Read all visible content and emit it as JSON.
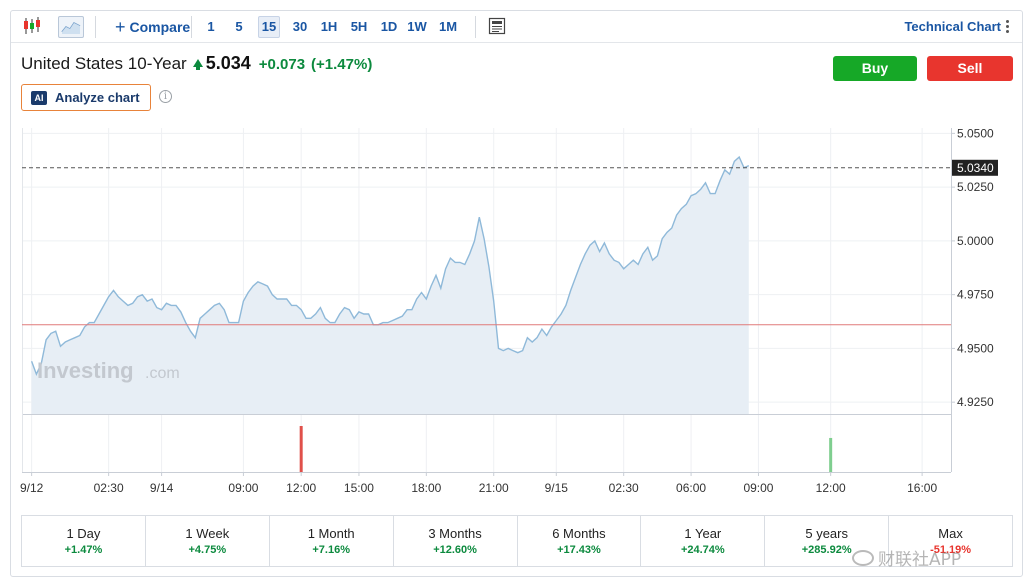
{
  "toolbar": {
    "compare_label": "Compare",
    "timeframes": [
      "1",
      "5",
      "15",
      "30",
      "1H",
      "5H",
      "1D",
      "1W",
      "1M"
    ],
    "active_timeframe": "15",
    "technical_chart_label": "Technical Chart"
  },
  "instrument": {
    "name": "United States 10-Year",
    "price": "5.034",
    "change": "+0.073",
    "change_pct": "(+1.47%)",
    "direction": "up"
  },
  "actions": {
    "buy_label": "Buy",
    "sell_label": "Sell"
  },
  "analyze": {
    "badge": "AI",
    "label": "Analyze chart"
  },
  "chart_data": {
    "type": "area",
    "ylim": [
      4.9195,
      5.0525
    ],
    "yticks": [
      "5.0500",
      "5.0250",
      "5.0000",
      "4.9750",
      "4.9500",
      "4.9250"
    ],
    "ytick_values": [
      5.05,
      5.025,
      5.0,
      4.975,
      4.95,
      4.925
    ],
    "last_value": 5.034,
    "last_value_label": "5.0340",
    "previous_close": 4.961,
    "xticks": [
      "9/12",
      "02:30",
      "9/14",
      "09:00",
      "12:00",
      "15:00",
      "18:00",
      "21:00",
      "9/15",
      "02:30",
      "06:00",
      "09:00",
      "12:00",
      "16:00"
    ],
    "xtick_index": [
      0,
      16,
      27,
      44,
      56,
      68,
      82,
      96,
      109,
      123,
      137,
      151,
      166,
      185
    ],
    "x_index_range": [
      -2,
      191
    ],
    "values": [
      4.944,
      4.938,
      4.943,
      4.954,
      4.957,
      4.958,
      4.951,
      4.953,
      4.954,
      4.955,
      4.956,
      4.96,
      4.962,
      4.962,
      4.966,
      4.97,
      4.974,
      4.977,
      4.974,
      4.972,
      4.97,
      4.971,
      4.974,
      4.975,
      4.972,
      4.973,
      4.969,
      4.968,
      4.971,
      4.97,
      4.97,
      4.967,
      4.962,
      4.958,
      4.955,
      4.964,
      4.966,
      4.968,
      4.97,
      4.971,
      4.968,
      4.962,
      4.962,
      4.962,
      4.972,
      4.976,
      4.979,
      4.981,
      4.98,
      4.979,
      4.975,
      4.973,
      4.973,
      4.973,
      4.97,
      4.97,
      4.968,
      4.964,
      4.964,
      4.966,
      4.969,
      4.964,
      4.962,
      4.962,
      4.966,
      4.969,
      4.968,
      4.964,
      4.967,
      4.966,
      4.966,
      4.961,
      4.961,
      4.962,
      4.962,
      4.963,
      4.964,
      4.965,
      4.968,
      4.968,
      4.973,
      4.976,
      4.973,
      4.979,
      4.984,
      4.978,
      4.987,
      4.992,
      4.99,
      4.99,
      4.989,
      4.994,
      5.0,
      5.011,
      5.001,
      4.988,
      4.972,
      4.95,
      4.949,
      4.95,
      4.949,
      4.948,
      4.949,
      4.955,
      4.953,
      4.955,
      4.959,
      4.956,
      4.96,
      4.963,
      4.966,
      4.97,
      4.977,
      4.983,
      4.989,
      4.994,
      4.998,
      5.0,
      4.995,
      4.999,
      4.994,
      4.991,
      4.99,
      4.987,
      4.989,
      4.991,
      4.989,
      4.994,
      4.997,
      4.991,
      4.993,
      5.001,
      5.004,
      5.006,
      5.012,
      5.015,
      5.017,
      5.021,
      5.022,
      5.024,
      5.027,
      5.022,
      5.022,
      5.028,
      5.033,
      5.031,
      5.037,
      5.039,
      5.034,
      5.035
    ]
  },
  "volume": {
    "bars": [
      {
        "index": 56,
        "color": "#e0504a",
        "height_ratio": 1.0
      },
      {
        "index": 166,
        "color": "#7fce8f",
        "height_ratio": 0.74
      }
    ]
  },
  "brand_watermark": {
    "bold": "Investing",
    "suffix": ".com"
  },
  "periods": [
    {
      "label": "1 Day",
      "value": "+1.47%",
      "sign": "pos"
    },
    {
      "label": "1 Week",
      "value": "+4.75%",
      "sign": "pos"
    },
    {
      "label": "1 Month",
      "value": "+7.16%",
      "sign": "pos"
    },
    {
      "label": "3 Months",
      "value": "+12.60%",
      "sign": "pos"
    },
    {
      "label": "6 Months",
      "value": "+17.43%",
      "sign": "pos"
    },
    {
      "label": "1 Year",
      "value": "+24.74%",
      "sign": "pos"
    },
    {
      "label": "5 years",
      "value": "+285.92%",
      "sign": "pos"
    },
    {
      "label": "Max",
      "value": "-51.19%",
      "sign": "neg"
    }
  ],
  "overlay_watermark": "财联社APP",
  "colors": {
    "accent": "#1a56a3",
    "up": "#0c8a3e",
    "down": "#e8352e",
    "line": "#8fb9d9",
    "area": "#e7eef5",
    "prev_close": "#e07a7a",
    "label_bg": "#222222"
  }
}
